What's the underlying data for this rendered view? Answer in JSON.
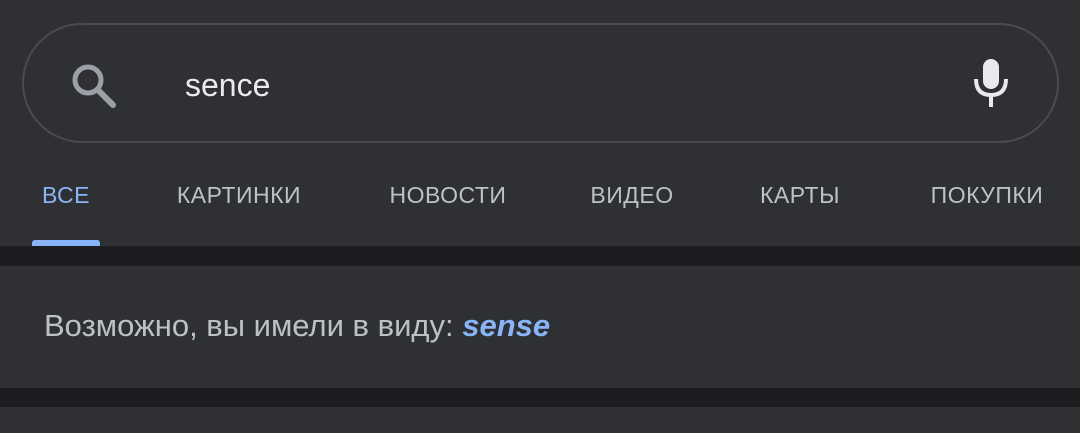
{
  "search": {
    "query": "sence"
  },
  "tabs": [
    {
      "label": "ВСЕ"
    },
    {
      "label": "КАРТИНКИ"
    },
    {
      "label": "НОВОСТИ"
    },
    {
      "label": "ВИДЕО"
    },
    {
      "label": "КАРТЫ"
    },
    {
      "label": "ПОКУПКИ"
    }
  ],
  "suggestion": {
    "prefix": "Возможно, вы имели в виду: ",
    "corrected": "sense"
  },
  "colors": {
    "background": "#1c1d20",
    "panel": "#2f3034",
    "accent": "#8ab4f8",
    "text": "#bdc1c6",
    "icon": "#e8eaed"
  }
}
